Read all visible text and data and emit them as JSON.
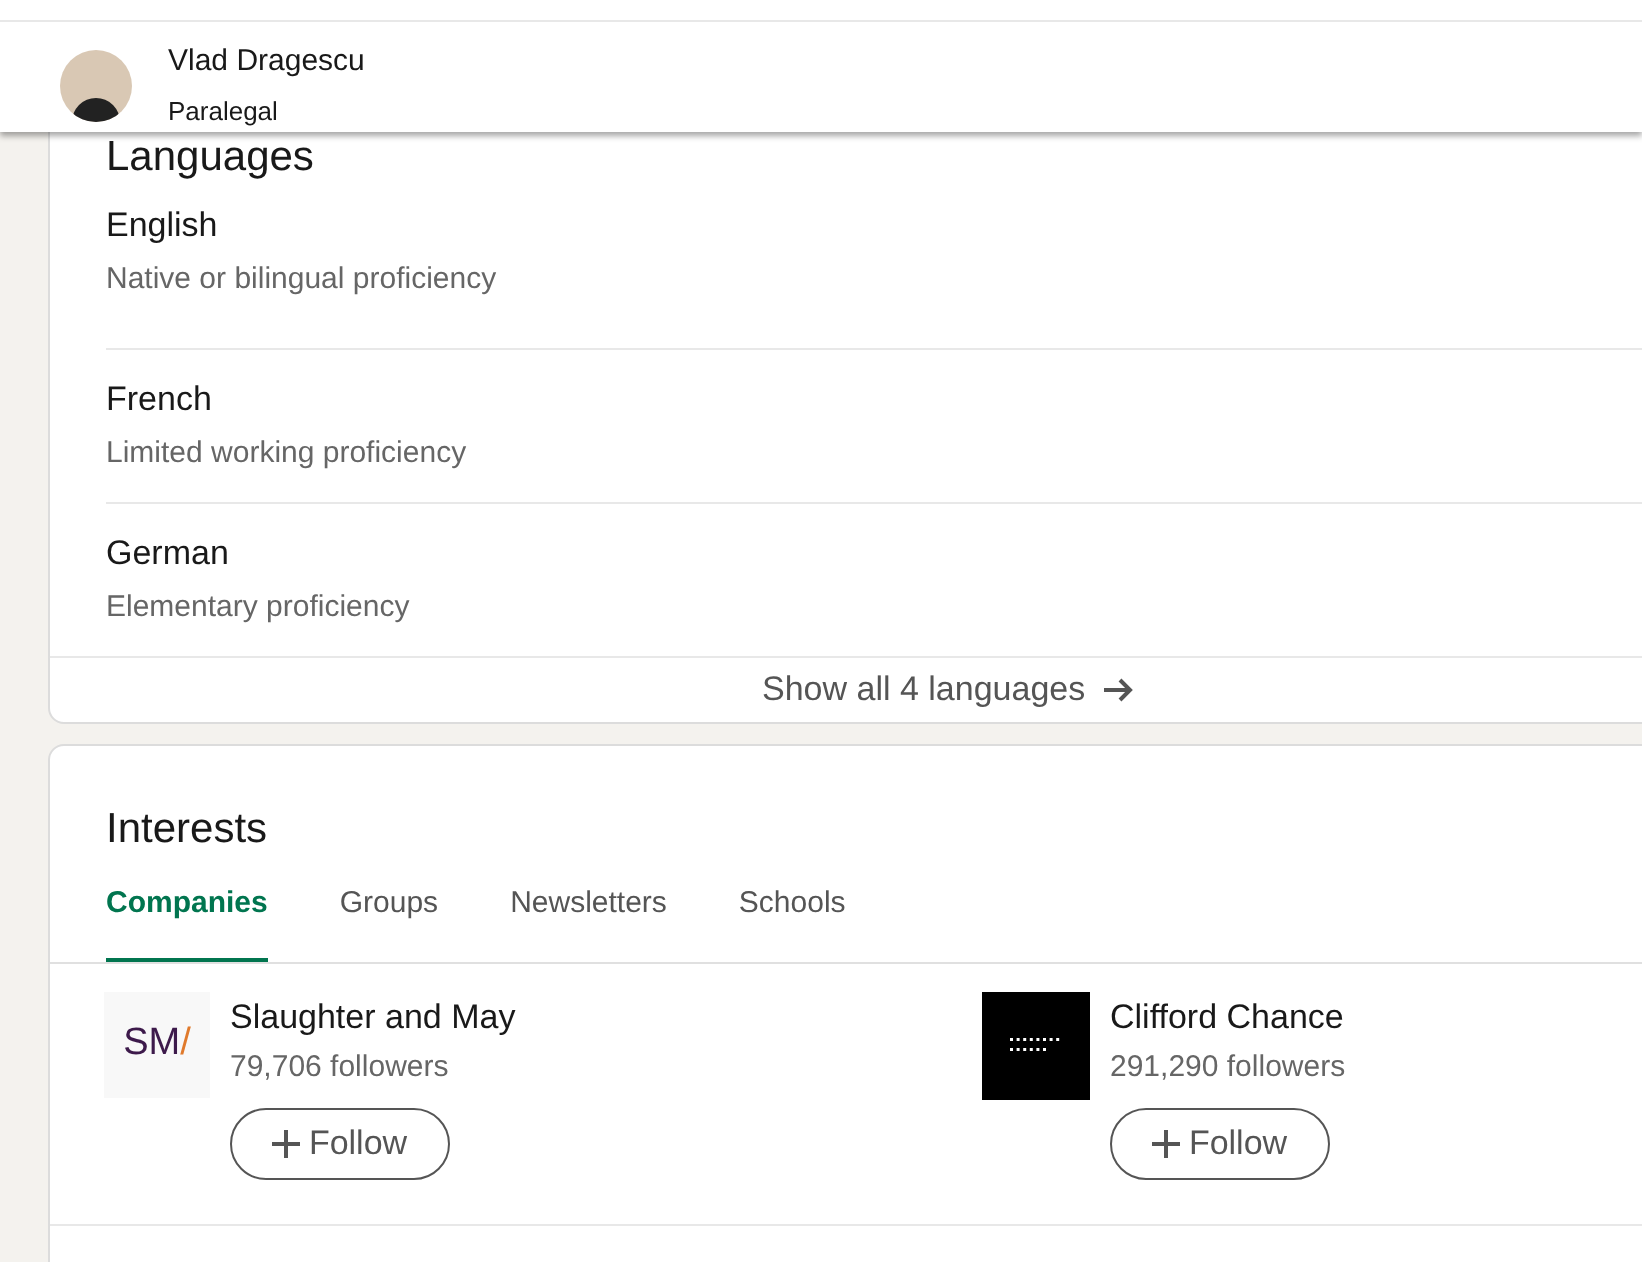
{
  "profile_bar": {
    "name": "Vlad Dragescu",
    "headline": "Paralegal"
  },
  "languages": {
    "title": "Languages",
    "items": [
      {
        "name": "English",
        "proficiency": "Native or bilingual proficiency"
      },
      {
        "name": "French",
        "proficiency": "Limited working proficiency"
      },
      {
        "name": "German",
        "proficiency": "Elementary proficiency"
      }
    ],
    "show_all": "Show all 4 languages"
  },
  "interests": {
    "title": "Interests",
    "tabs": [
      {
        "label": "Companies",
        "selected": true
      },
      {
        "label": "Groups",
        "selected": false
      },
      {
        "label": "Newsletters",
        "selected": false
      },
      {
        "label": "Schools",
        "selected": false
      }
    ],
    "companies": [
      {
        "name": "Slaughter and May",
        "followers": "79,706 followers",
        "kind": "text",
        "logo_text": "SM/",
        "button": "Follow"
      },
      {
        "name": "Clifford Chance",
        "followers": "291,290 followers",
        "kind": "dark",
        "button": "Follow"
      }
    ]
  }
}
